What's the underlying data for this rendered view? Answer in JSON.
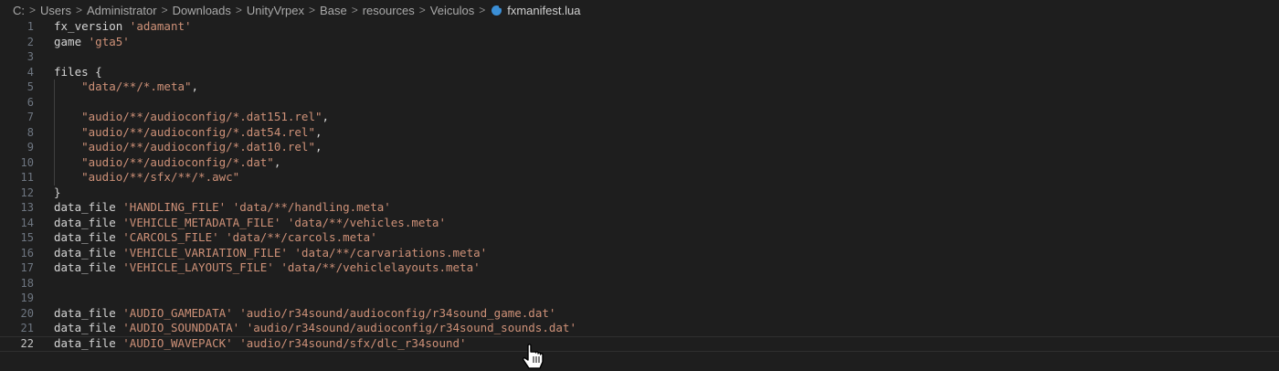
{
  "breadcrumb": {
    "items": [
      "C:",
      "Users",
      "Administrator",
      "Downloads",
      "UnityVrpex",
      "Base",
      "resources",
      "Veiculos"
    ],
    "file": "fxmanifest.lua",
    "separator": ">"
  },
  "editor": {
    "current_line": 22,
    "lines": [
      {
        "n": "1",
        "segs": [
          [
            "fx_version ",
            "kw"
          ],
          [
            "'adamant'",
            "str"
          ]
        ]
      },
      {
        "n": "2",
        "segs": [
          [
            "game ",
            "kw"
          ],
          [
            "'gta5'",
            "str"
          ]
        ]
      },
      {
        "n": "3",
        "segs": []
      },
      {
        "n": "4",
        "segs": [
          [
            "files {",
            "kw"
          ]
        ]
      },
      {
        "n": "5",
        "indent": true,
        "segs": [
          [
            "    ",
            "kw"
          ],
          [
            "\"data/**/*.meta\"",
            "str"
          ],
          [
            ",",
            "kw"
          ]
        ]
      },
      {
        "n": "6",
        "indent": true,
        "segs": []
      },
      {
        "n": "7",
        "indent": true,
        "segs": [
          [
            "    ",
            "kw"
          ],
          [
            "\"audio/**/audioconfig/*.dat151.rel\"",
            "str"
          ],
          [
            ",",
            "kw"
          ]
        ]
      },
      {
        "n": "8",
        "indent": true,
        "segs": [
          [
            "    ",
            "kw"
          ],
          [
            "\"audio/**/audioconfig/*.dat54.rel\"",
            "str"
          ],
          [
            ",",
            "kw"
          ]
        ]
      },
      {
        "n": "9",
        "indent": true,
        "segs": [
          [
            "    ",
            "kw"
          ],
          [
            "\"audio/**/audioconfig/*.dat10.rel\"",
            "str"
          ],
          [
            ",",
            "kw"
          ]
        ]
      },
      {
        "n": "10",
        "indent": true,
        "segs": [
          [
            "    ",
            "kw"
          ],
          [
            "\"audio/**/audioconfig/*.dat\"",
            "str"
          ],
          [
            ",",
            "kw"
          ]
        ]
      },
      {
        "n": "11",
        "indent": true,
        "segs": [
          [
            "    ",
            "kw"
          ],
          [
            "\"audio/**/sfx/**/*.awc\"",
            "str"
          ]
        ]
      },
      {
        "n": "12",
        "segs": [
          [
            "}",
            "kw"
          ]
        ]
      },
      {
        "n": "13",
        "segs": [
          [
            "data_file ",
            "kw"
          ],
          [
            "'HANDLING_FILE'",
            "str"
          ],
          [
            " ",
            "kw"
          ],
          [
            "'data/**/handling.meta'",
            "str"
          ]
        ]
      },
      {
        "n": "14",
        "segs": [
          [
            "data_file ",
            "kw"
          ],
          [
            "'VEHICLE_METADATA_FILE'",
            "str"
          ],
          [
            " ",
            "kw"
          ],
          [
            "'data/**/vehicles.meta'",
            "str"
          ]
        ]
      },
      {
        "n": "15",
        "segs": [
          [
            "data_file ",
            "kw"
          ],
          [
            "'CARCOLS_FILE'",
            "str"
          ],
          [
            " ",
            "kw"
          ],
          [
            "'data/**/carcols.meta'",
            "str"
          ]
        ]
      },
      {
        "n": "16",
        "segs": [
          [
            "data_file ",
            "kw"
          ],
          [
            "'VEHICLE_VARIATION_FILE'",
            "str"
          ],
          [
            " ",
            "kw"
          ],
          [
            "'data/**/carvariations.meta'",
            "str"
          ]
        ]
      },
      {
        "n": "17",
        "segs": [
          [
            "data_file ",
            "kw"
          ],
          [
            "'VEHICLE_LAYOUTS_FILE'",
            "str"
          ],
          [
            " ",
            "kw"
          ],
          [
            "'data/**/vehiclelayouts.meta'",
            "str"
          ]
        ]
      },
      {
        "n": "18",
        "segs": []
      },
      {
        "n": "19",
        "segs": []
      },
      {
        "n": "20",
        "segs": [
          [
            "data_file ",
            "kw"
          ],
          [
            "'AUDIO_GAMEDATA'",
            "str"
          ],
          [
            " ",
            "kw"
          ],
          [
            "'audio/r34sound/audioconfig/r34sound_game.dat'",
            "str"
          ]
        ]
      },
      {
        "n": "21",
        "segs": [
          [
            "data_file ",
            "kw"
          ],
          [
            "'AUDIO_SOUNDDATA'",
            "str"
          ],
          [
            " ",
            "kw"
          ],
          [
            "'audio/r34sound/audioconfig/r34sound_sounds.dat'",
            "str"
          ]
        ]
      },
      {
        "n": "22",
        "segs": [
          [
            "data_file ",
            "kw"
          ],
          [
            "'AUDIO_WAVEPACK'",
            "str"
          ],
          [
            " ",
            "kw"
          ],
          [
            "'audio/r34sound/sfx/dlc_r34sound'",
            "str"
          ]
        ]
      }
    ]
  },
  "icons": {
    "file_icon": "lua-file-icon",
    "cursor": "hand-pointer-icon"
  },
  "colors": {
    "background": "#1e1e1e",
    "string": "#ce9178",
    "text": "#d4d4d4",
    "line_number": "#6e7681"
  }
}
